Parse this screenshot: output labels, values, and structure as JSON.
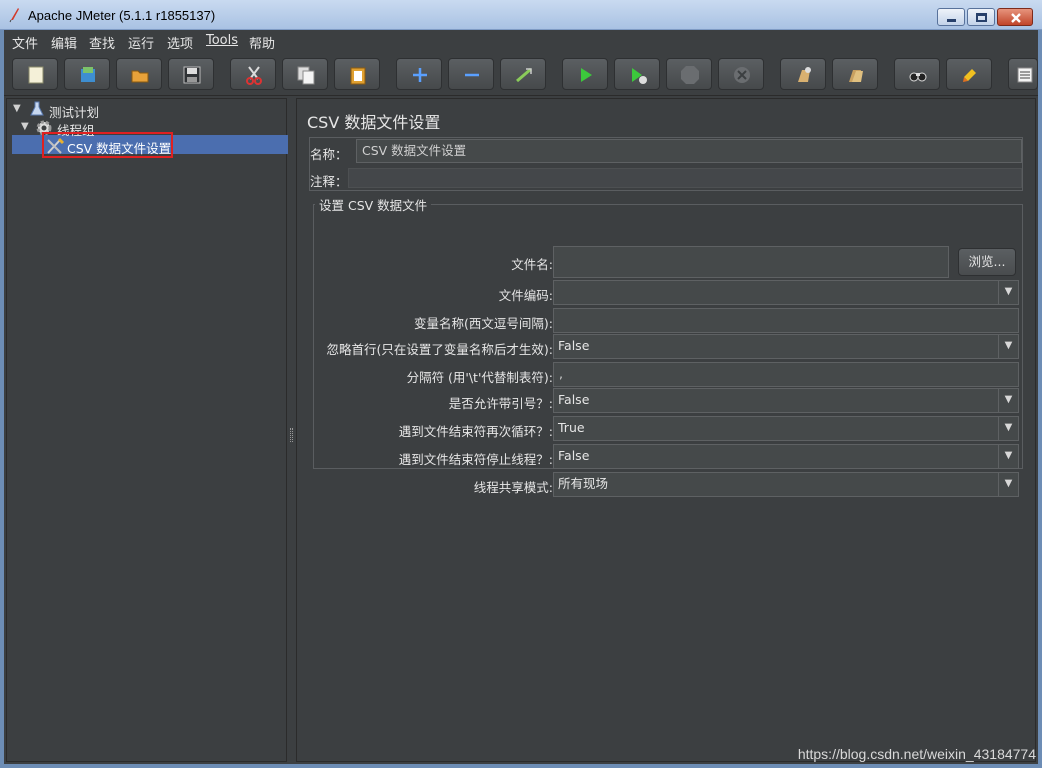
{
  "window": {
    "title": "Apache JMeter (5.1.1 r1855137)"
  },
  "menubar": [
    "文件",
    "编辑",
    "查找",
    "运行",
    "选项",
    "Tools",
    "帮助"
  ],
  "toolbar": [
    {
      "name": "new-icon"
    },
    {
      "name": "templates-icon"
    },
    {
      "name": "open-icon"
    },
    {
      "name": "save-icon"
    },
    {
      "name": "cut-icon"
    },
    {
      "name": "copy-icon"
    },
    {
      "name": "paste-icon"
    },
    {
      "name": "expand-icon"
    },
    {
      "name": "collapse-icon"
    },
    {
      "name": "toggle-icon"
    },
    {
      "name": "start-icon"
    },
    {
      "name": "start-no-pause-icon"
    },
    {
      "name": "stop-icon"
    },
    {
      "name": "shutdown-icon"
    },
    {
      "name": "clear-icon"
    },
    {
      "name": "clear-all-icon"
    },
    {
      "name": "search-icon"
    },
    {
      "name": "reset-search-icon"
    },
    {
      "name": "function-helper-icon"
    }
  ],
  "tree": {
    "items": [
      {
        "label": "测试计划",
        "icon": "test-plan-icon"
      },
      {
        "label": "线程组",
        "icon": "thread-group-icon"
      },
      {
        "label": "CSV 数据文件设置",
        "icon": "csv-config-icon",
        "selected": true
      }
    ]
  },
  "content": {
    "title": "CSV 数据文件设置",
    "name_label": "名称：",
    "name_value": "CSV 数据文件设置",
    "comment_label": "注释：",
    "comment_value": "",
    "group_title": "设置 CSV 数据文件",
    "browse_button": "浏览...",
    "fields": [
      {
        "label": "文件名:",
        "value": "",
        "type": "text"
      },
      {
        "label": "文件编码:",
        "value": "",
        "type": "combo"
      },
      {
        "label": "变量名称(西文逗号间隔):",
        "value": "",
        "type": "text"
      },
      {
        "label": "忽略首行(只在设置了变量名称后才生效):",
        "value": "False",
        "type": "combo"
      },
      {
        "label": "分隔符 (用'\\t'代替制表符):",
        "value": ",",
        "type": "text"
      },
      {
        "label": "是否允许带引号？:",
        "value": "False",
        "type": "combo"
      },
      {
        "label": "遇到文件结束符再次循环？:",
        "value": "True",
        "type": "combo"
      },
      {
        "label": "遇到文件结束符停止线程？:",
        "value": "False",
        "type": "combo"
      },
      {
        "label": "线程共享模式:",
        "value": "所有现场",
        "type": "combo"
      }
    ]
  },
  "watermark": "https://blog.csdn.net/weixin_43184774"
}
